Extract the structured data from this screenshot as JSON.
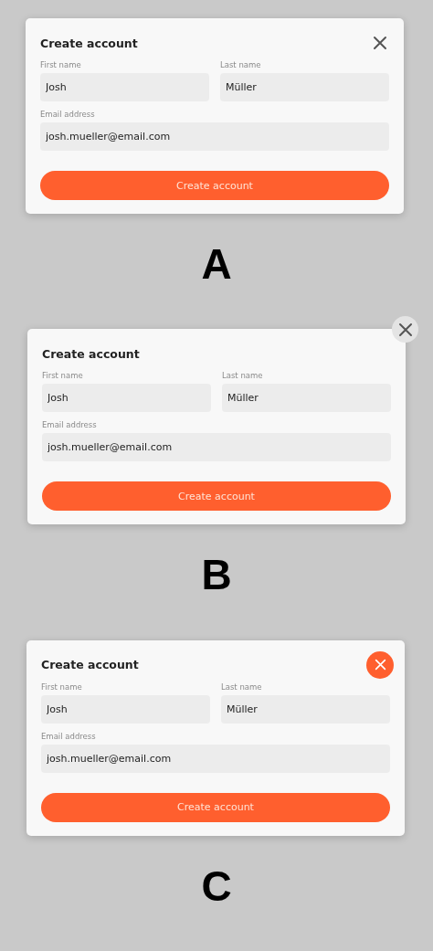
{
  "variants": [
    {
      "label": "A",
      "close": {
        "kind": "plain"
      },
      "title": "Create account",
      "fields": [
        {
          "label": "First name",
          "value": "Josh"
        },
        {
          "label": "Last name",
          "value": "Müller"
        },
        {
          "label": "Email address",
          "value": "josh.mueller@email.com"
        }
      ],
      "submit": "Create account"
    },
    {
      "label": "B",
      "close": {
        "kind": "corner"
      },
      "title": "Create account",
      "fields": [
        {
          "label": "First name",
          "value": "Josh"
        },
        {
          "label": "Last name",
          "value": "Müller"
        },
        {
          "label": "Email address",
          "value": "josh.mueller@email.com"
        }
      ],
      "submit": "Create account"
    },
    {
      "label": "C",
      "close": {
        "kind": "filled"
      },
      "title": "Create account",
      "fields": [
        {
          "label": "First name",
          "value": "Josh"
        },
        {
          "label": "Last name",
          "value": "Müller"
        },
        {
          "label": "Email address",
          "value": "josh.mueller@email.com"
        }
      ],
      "submit": "Create account"
    }
  ]
}
